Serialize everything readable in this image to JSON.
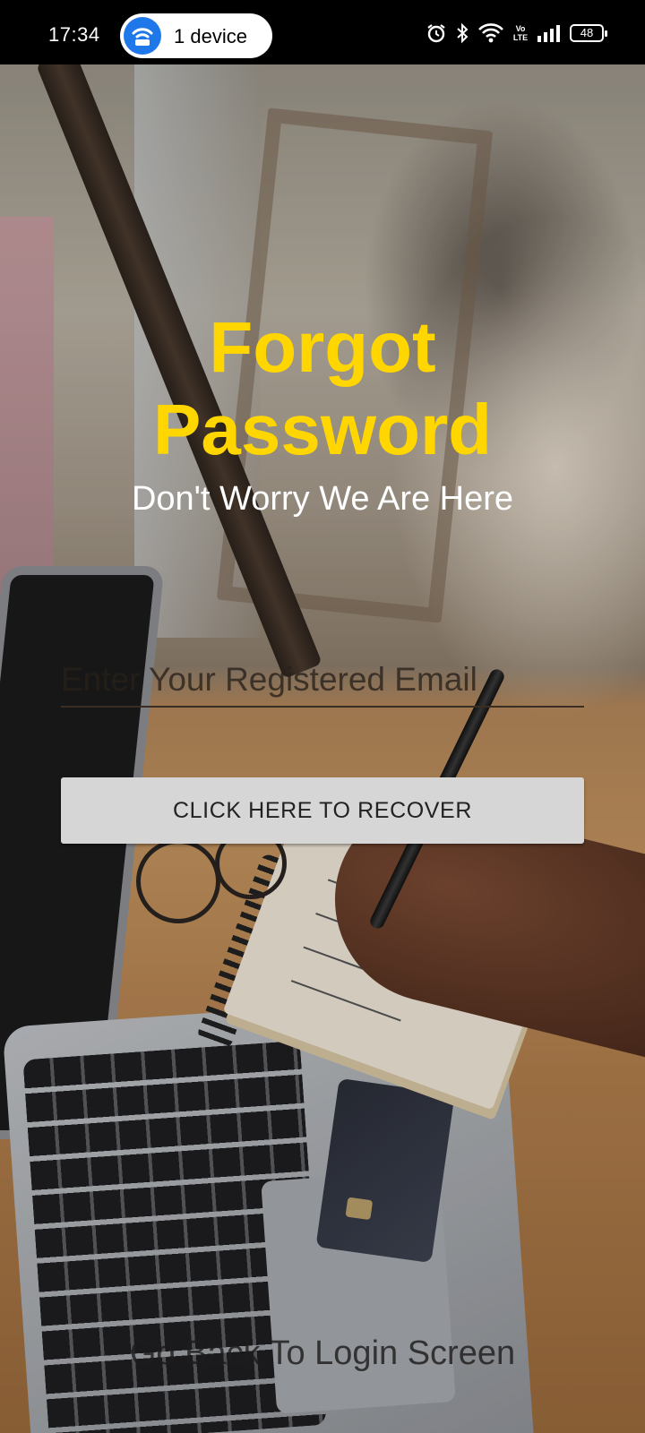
{
  "status_bar": {
    "time": "17:34",
    "hotspot_label": "1 device",
    "battery": "48",
    "volte_top": "Vo",
    "volte_bottom": "LTE",
    "icons": [
      "alarm-icon",
      "bluetooth-icon",
      "wifi-icon",
      "volte-icon",
      "signal-icon",
      "battery-icon"
    ]
  },
  "header": {
    "title_line1": "Forgot",
    "title_line2": "Password",
    "subtitle": "Don't Worry We Are Here"
  },
  "form": {
    "email_placeholder": "Enter Your Registered Email",
    "email_value": "",
    "recover_button": "CLICK HERE TO RECOVER"
  },
  "footer": {
    "back_link": "Go Back To Login Screen"
  },
  "colors": {
    "title": "#ffd600",
    "button_bg": "#d6d6d6",
    "hotspot_accent": "#1f78ea"
  }
}
